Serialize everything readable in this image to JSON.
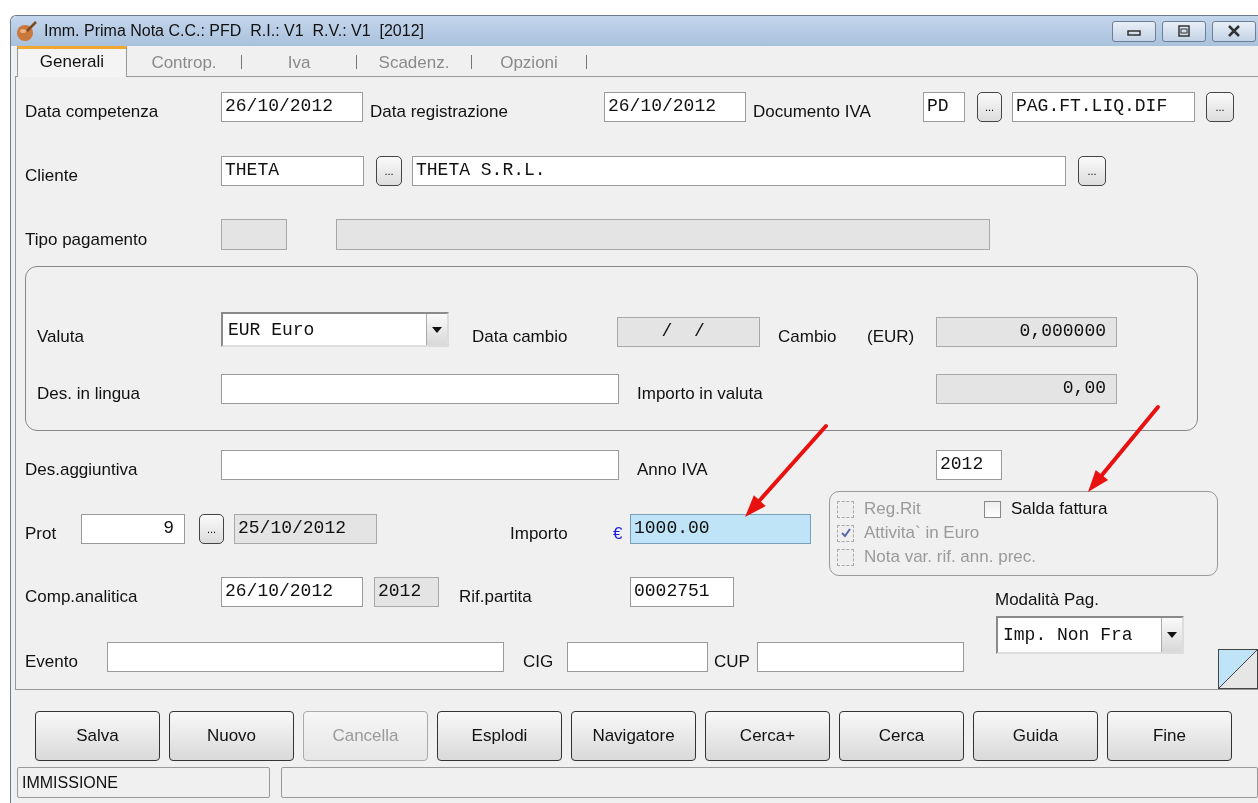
{
  "window": {
    "title": "Imm. Prima Nota C.C.: PFD  R.I.: V1  R.V.: V1  [2012]"
  },
  "tabs": [
    {
      "label": "Generali",
      "selected": true
    },
    {
      "label": "Controp.",
      "selected": false
    },
    {
      "label": "Iva",
      "selected": false
    },
    {
      "label": "Scadenz.",
      "selected": false
    },
    {
      "label": "Opzioni",
      "selected": false
    }
  ],
  "header": {
    "data_competenza": {
      "label": "Data competenza",
      "field": {
        "value": "26/10/2012",
        "disabled": false
      }
    },
    "data_registrazione": {
      "label": "Data registrazione",
      "field": {
        "value": "26/10/2012",
        "disabled": false
      }
    },
    "documento_iva": {
      "label": "Documento IVA",
      "code": {
        "value": "PD",
        "disabled": false
      },
      "code_button": "...",
      "description": {
        "value": "PAG.FT.LIQ.DIF",
        "disabled": false
      },
      "description_button": "..."
    },
    "cliente": {
      "label": "Cliente",
      "code": {
        "value": "THETA",
        "disabled": false
      },
      "code_button": "...",
      "description": {
        "value": "THETA S.R.L.",
        "disabled": false
      },
      "description_button": "..."
    },
    "tipo_pagamento": {
      "label": "Tipo pagamento",
      "code": {
        "disabled": true
      },
      "description": {
        "disabled": true
      }
    }
  },
  "valuta_group": {
    "valuta": {
      "label": "Valuta",
      "value": "EUR Euro"
    },
    "data_cambio": {
      "label": "Data cambio",
      "field": {
        "value": "  /  /",
        "disabled": true
      }
    },
    "cambio": {
      "label": "Cambio",
      "currency": "(EUR)",
      "field": {
        "value": "0,000000",
        "disabled": true
      }
    },
    "des_in_lingua": {
      "label": "Des. in lingua",
      "field": {
        "disabled": false
      }
    },
    "importo_in_valuta": {
      "label": "Importo in valuta",
      "field": {
        "value": "0,00",
        "disabled": true
      }
    }
  },
  "des_aggiuntiva": {
    "label": "Des.aggiuntiva",
    "field": {
      "disabled": false
    }
  },
  "anno_iva": {
    "label": "Anno IVA",
    "field": {
      "value": "2012",
      "disabled": false
    }
  },
  "prot": {
    "label": "Prot",
    "number": {
      "value": "9",
      "disabled": false
    },
    "button": "...",
    "date": {
      "value": "25/10/2012",
      "disabled": true
    }
  },
  "importo": {
    "label": "Importo",
    "currency": "€",
    "field": {
      "value": "1000.00",
      "focused": true
    }
  },
  "comp_analitica": {
    "label": "Comp.analitica",
    "date": {
      "value": "26/10/2012",
      "disabled": false
    },
    "year": {
      "value": "2012",
      "disabled": true
    }
  },
  "rif_partita": {
    "label": "Rif.partita",
    "field": {
      "value": "0002751",
      "disabled": false
    }
  },
  "evento": {
    "label": "Evento",
    "field": {
      "disabled": false
    }
  },
  "cig": {
    "label": "CIG",
    "field": {
      "disabled": false
    }
  },
  "cup": {
    "label": "CUP",
    "field": {
      "disabled": false
    }
  },
  "options": [
    {
      "label": "Reg.Rit",
      "checked": false,
      "disabled": true
    },
    {
      "label": "Salda fattura",
      "checked": false,
      "disabled": false
    },
    {
      "label": "Attivita` in Euro",
      "checked": true,
      "disabled": true
    },
    {
      "label": "Nota var. rif. ann. prec.",
      "checked": false,
      "disabled": true
    }
  ],
  "modalita_pag": {
    "label": "Modalità Pag.",
    "value": "Imp. Non Fra"
  },
  "buttons": [
    {
      "label": "Salva",
      "disabled": false
    },
    {
      "label": "Nuovo",
      "disabled": false
    },
    {
      "label": "Cancella",
      "disabled": true
    },
    {
      "label": "Esplodi",
      "disabled": false
    },
    {
      "label": "Navigatore",
      "disabled": false
    },
    {
      "label": "Cerca+",
      "disabled": false
    },
    {
      "label": "Cerca",
      "disabled": false
    },
    {
      "label": "Guida",
      "disabled": false
    },
    {
      "label": "Fine",
      "disabled": false
    }
  ],
  "status_bar": {
    "mode": "IMMISSIONE"
  }
}
